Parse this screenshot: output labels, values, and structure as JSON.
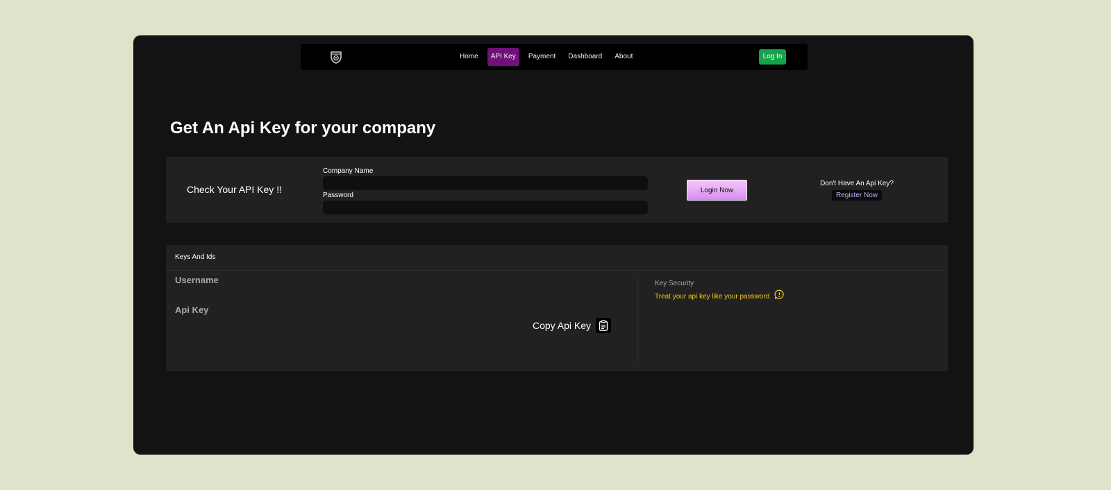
{
  "nav": {
    "logo_icon": "shield-eye-icon",
    "links": [
      "Home",
      "API Key",
      "Payment",
      "Dashboard",
      "About"
    ],
    "active_link": "API Key",
    "login_label": "Log In",
    "accent_color": "#72107a",
    "login_color": "#16a34a"
  },
  "page": {
    "title": "Get An Api Key for your company"
  },
  "check": {
    "heading": "Check Your API Key !!",
    "company_label": "Company Name",
    "company_value": "",
    "password_label": "Password",
    "password_value": "",
    "login_button": "Login Now",
    "no_key_text": "Don't Have An Api Key?",
    "register_link": "Register Now"
  },
  "keys": {
    "header": "Keys And Ids",
    "username_label": "Username",
    "apikey_label": "Api Key",
    "copy_label": "Copy Api Key",
    "copy_icon": "clipboard-icon",
    "security_title": "Key Security",
    "security_note": "Treat your api key like your password",
    "security_icon": "warning-chat-icon",
    "note_color": "#f5c518"
  }
}
